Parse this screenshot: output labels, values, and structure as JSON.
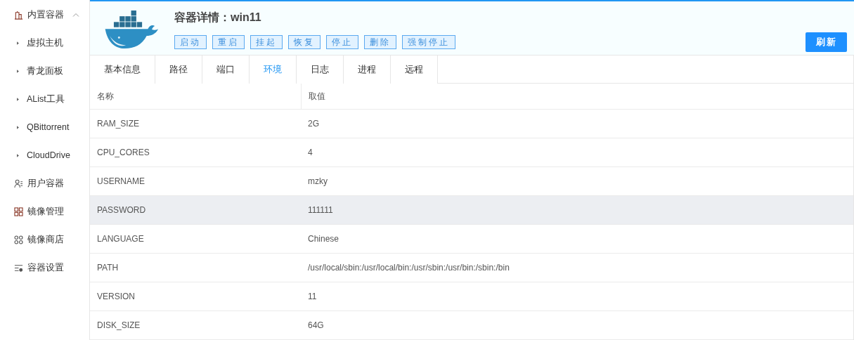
{
  "sidebar": {
    "items": [
      {
        "label": "内置容器",
        "expanded": true,
        "children": [
          {
            "label": "虚拟主机"
          },
          {
            "label": "青龙面板"
          },
          {
            "label": "AList工具"
          },
          {
            "label": "QBittorrent"
          },
          {
            "label": "CloudDrive"
          }
        ]
      },
      {
        "label": "用户容器"
      },
      {
        "label": "镜像管理"
      },
      {
        "label": "镜像商店"
      },
      {
        "label": "容器设置"
      }
    ]
  },
  "header": {
    "title": "容器详情：win11",
    "actions": [
      "启动",
      "重启",
      "挂起",
      "恢复",
      "停止",
      "删除",
      "强制停止"
    ],
    "refresh_button": "刷新"
  },
  "tabs": [
    {
      "label": "基本信息",
      "selected": false
    },
    {
      "label": "路径",
      "selected": false
    },
    {
      "label": "端口",
      "selected": false
    },
    {
      "label": "环境",
      "selected": true
    },
    {
      "label": "日志",
      "selected": false
    },
    {
      "label": "进程",
      "selected": false
    },
    {
      "label": "远程",
      "selected": false
    }
  ],
  "table": {
    "columns": [
      "名称",
      "取值"
    ],
    "rows": [
      {
        "name": "RAM_SIZE",
        "value": "2G",
        "highlighted": false
      },
      {
        "name": "CPU_CORES",
        "value": "4",
        "highlighted": false
      },
      {
        "name": "USERNAME",
        "value": "mzky",
        "highlighted": false
      },
      {
        "name": "PASSWORD",
        "value": "111111",
        "highlighted": true
      },
      {
        "name": "LANGUAGE",
        "value": "Chinese",
        "highlighted": false
      },
      {
        "name": "PATH",
        "value": "/usr/local/sbin:/usr/local/bin:/usr/sbin:/usr/bin:/sbin:/bin",
        "highlighted": false
      },
      {
        "name": "VERSION",
        "value": "11",
        "highlighted": false
      },
      {
        "name": "DISK_SIZE",
        "value": "64G",
        "highlighted": false
      }
    ]
  }
}
